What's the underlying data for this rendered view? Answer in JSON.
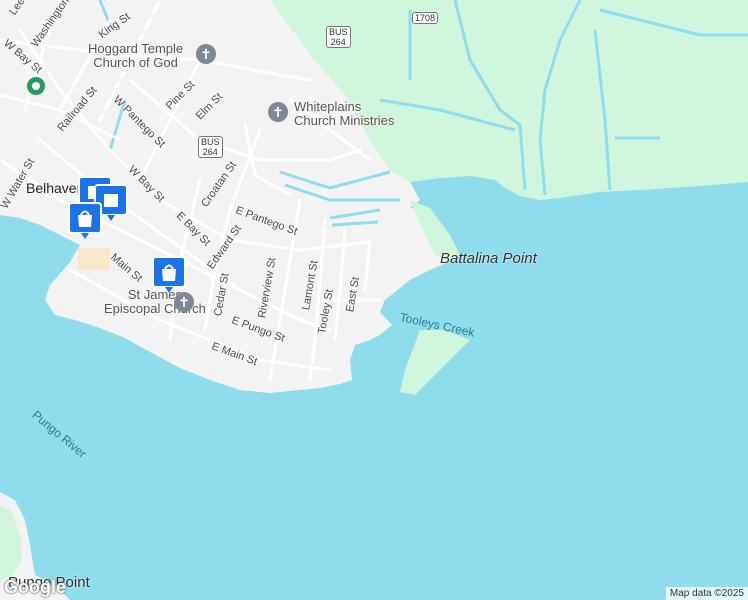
{
  "colors": {
    "water": "#8fdcec",
    "land": "#f3f3f3",
    "wetland": "#cff5dc",
    "road": "#ffffff",
    "poi_pin": "#1a73e8"
  },
  "map": {
    "town": "Belhaven",
    "places": {
      "battalina_point": "Battalina Point",
      "tooleys_creek": "Tooleys Creek",
      "pungo_river": "Pungo River",
      "pungo_point": "Pungo Point"
    },
    "pois": {
      "hoggard_line1": "Hoggard Temple",
      "hoggard_line2": "Church of God",
      "whiteplains_line1": "Whiteplains",
      "whiteplains_line2": "Church Ministries",
      "stjames_line1": "St James",
      "stjames_line2": "Episcopal Church"
    },
    "shields": {
      "bus_top": "BUS",
      "route_top": "264",
      "bus_mid": "BUS",
      "route_mid": "264",
      "county_road": "1708"
    },
    "streets": {
      "lee": "Lee St",
      "washington": "Washington St",
      "w_bay_top": "W Bay St",
      "king": "King St",
      "railroad": "Railroad St",
      "w_pantego": "W Pantego St",
      "pine": "Pine St",
      "elm": "Elm St",
      "w_water": "W Water St",
      "w_bay": "W Bay St",
      "e_bay": "E Bay St",
      "croatan": "Croatan St",
      "e_pantego": "E Pantego St",
      "edward": "Edward St",
      "main": "Main St",
      "cedar": "Cedar St",
      "riverview": "Riverview St",
      "lamont": "Lamont St",
      "tooley": "Tooley St",
      "east": "East St",
      "e_pungo": "E Pungo St",
      "e_main": "E Main St"
    }
  },
  "footer": {
    "logo": "Google",
    "attribution": "Map data ©2025"
  }
}
